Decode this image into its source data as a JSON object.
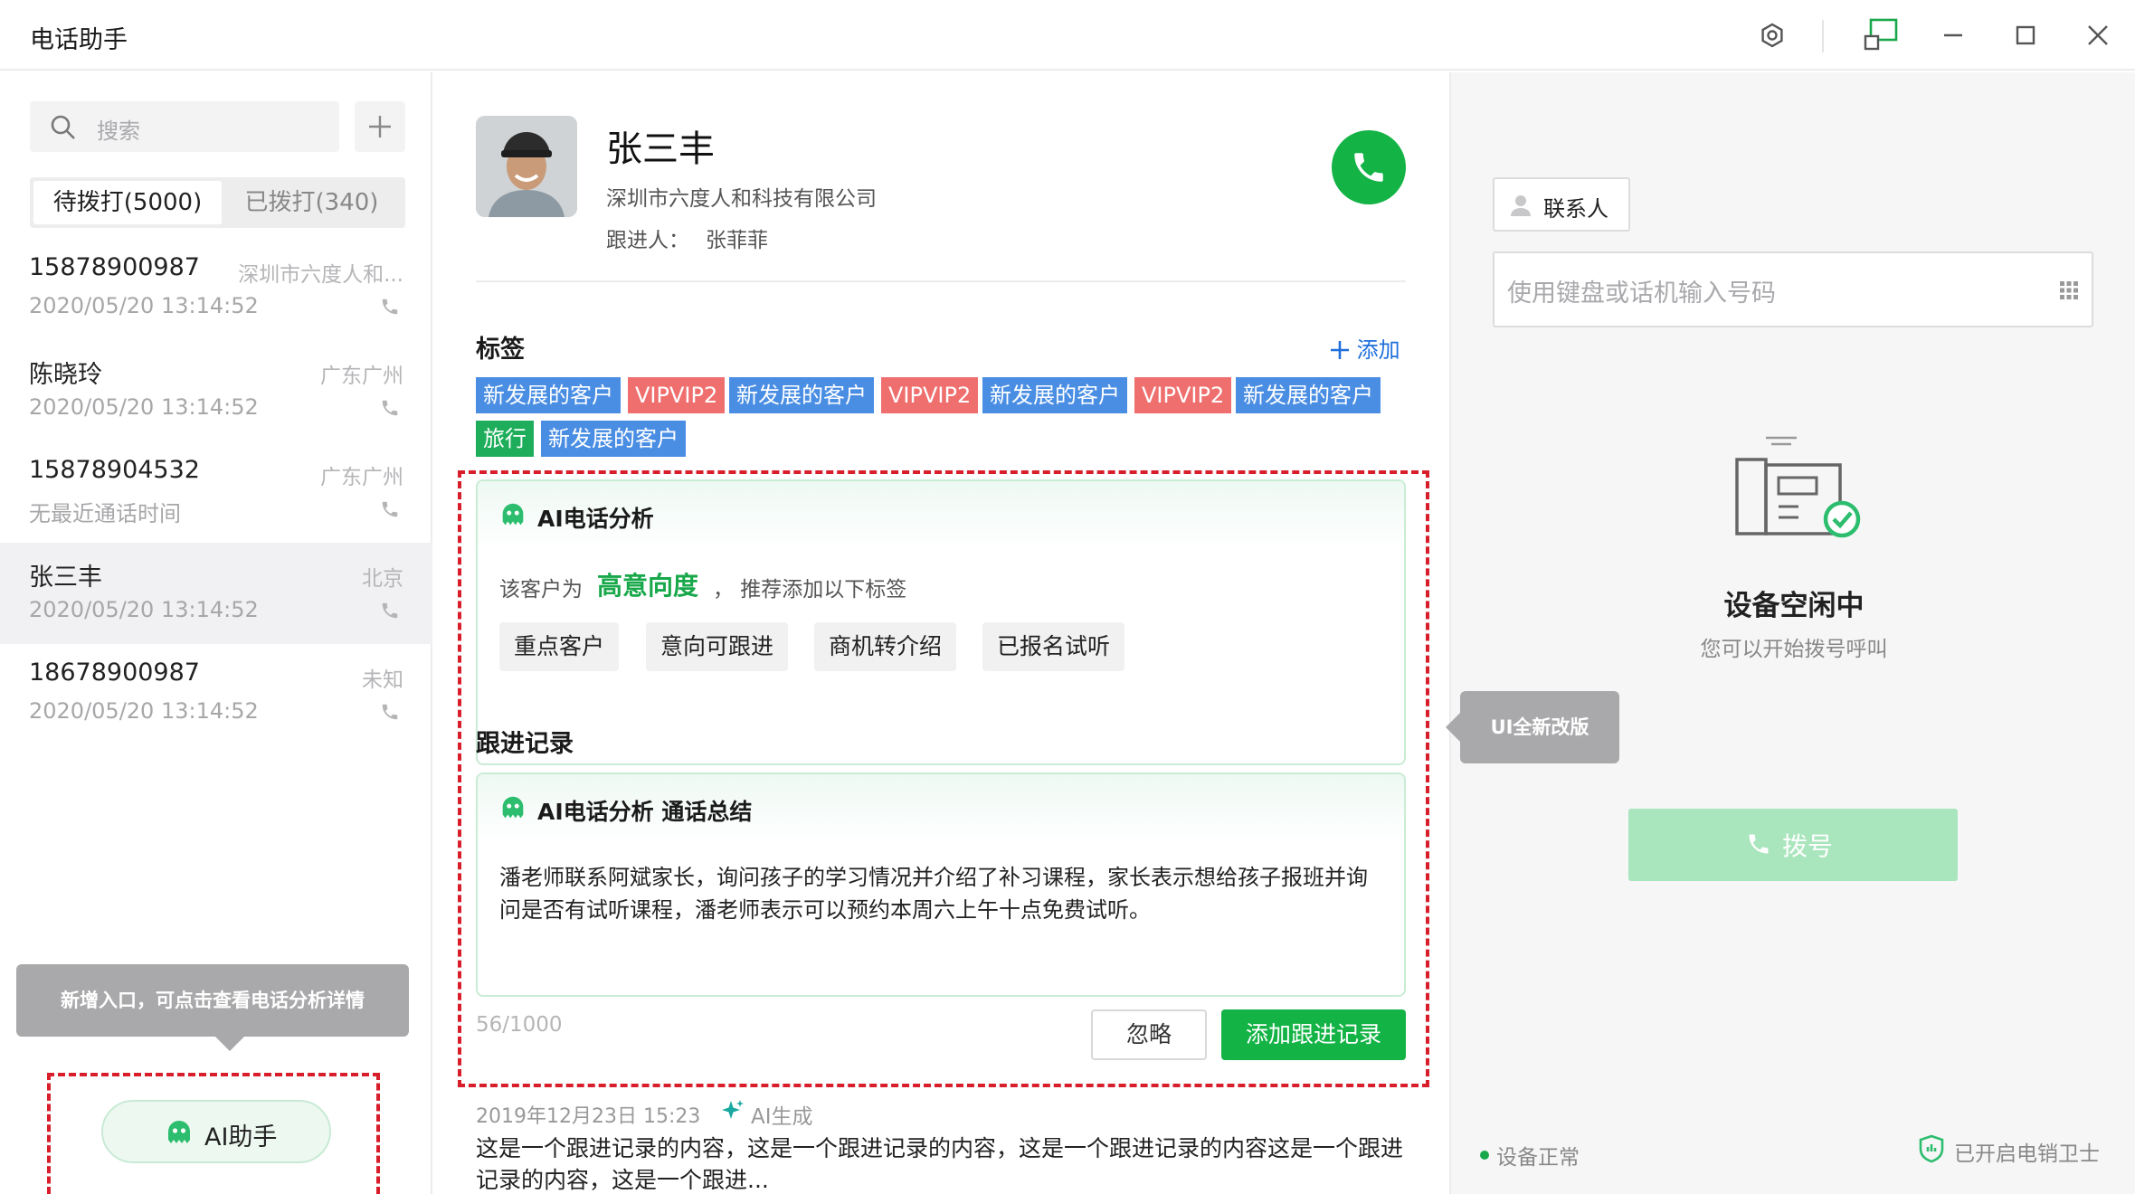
{
  "app": {
    "title": "电话助手"
  },
  "window_controls": {
    "icons": [
      "settings-icon",
      "screen-share-icon",
      "minimize-icon",
      "maximize-icon",
      "close-icon"
    ]
  },
  "sidebar": {
    "search_placeholder": "搜索",
    "tabs": [
      {
        "label": "待拨打(5000)",
        "active": true
      },
      {
        "label": "已拨打(340)",
        "active": false
      }
    ],
    "contacts": [
      {
        "name": "15878900987",
        "location": "深圳市六度人和...",
        "time": "2020/05/20 13:14:52"
      },
      {
        "name": "陈晓玲",
        "location": "广东广州",
        "time": "2020/05/20 13:14:52"
      },
      {
        "name": "15878904532",
        "location": "广东广州",
        "time": "无最近通话时间"
      },
      {
        "name": "张三丰",
        "location": "北京",
        "time": "2020/05/20 13:14:52",
        "selected": true
      },
      {
        "name": "18678900987",
        "location": "未知",
        "time": "2020/05/20 13:14:52"
      }
    ],
    "tooltip": "新增入口，可点击查看电话分析详情",
    "ai_button_label": "AI助手"
  },
  "customer": {
    "name": "张三丰",
    "company": "深圳市六度人和科技有限公司",
    "follower_label": "跟进人：",
    "follower": "张菲菲"
  },
  "tags": {
    "title": "标签",
    "add_label": "添加",
    "items": [
      {
        "label": "新发展的客户",
        "color": "#4a8ee4"
      },
      {
        "label": "VIPVIP2",
        "color": "#ef6f6f"
      },
      {
        "label": "新发展的客户",
        "color": "#4a8ee4"
      },
      {
        "label": "VIPVIP2",
        "color": "#ef6f6f"
      },
      {
        "label": "新发展的客户",
        "color": "#4a8ee4"
      },
      {
        "label": "VIPVIP2",
        "color": "#ef6f6f"
      },
      {
        "label": "新发展的客户",
        "color": "#4a8ee4"
      },
      {
        "label": "旅行",
        "color": "#1eae5b"
      },
      {
        "label": "新发展的客户",
        "color": "#4a8ee4"
      }
    ]
  },
  "ai_analysis": {
    "title": "AI电话分析",
    "intent_prefix": "该客户为",
    "intent_value": "高意向度",
    "intent_suffix": "，  推荐添加以下标签",
    "suggested_tags": [
      "重点客户",
      "意向可跟进",
      "商机转介绍",
      "已报名试听"
    ]
  },
  "follow_records": {
    "title": "跟进记录",
    "summary_title": "AI电话分析 通话总结",
    "summary_text": "潘老师联系阿斌家长，询问孩子的学习情况并介绍了补习课程，家长表示想给孩子报班并询问是否有试听课程，潘老师表示可以预约本周六上午十点免费试听。",
    "counter": "56/1000",
    "ignore_label": "忽略",
    "add_label": "添加跟进记录",
    "record_date": "2019年12月23日  15:23",
    "record_ai_label": "AI生成",
    "record_text": "这是一个跟进记录的内容，这是一个跟进记录的内容，这是一个跟进记录的内容这是一个跟进记录的内容，这是一个跟进..."
  },
  "dialer": {
    "contacts_label": "联系人",
    "input_placeholder": "使用键盘或话机输入号码",
    "idle_title": "设备空闲中",
    "idle_subtitle": "您可以开始拨号呼叫",
    "dial_label": "拨号",
    "status_text": "设备正常",
    "guard_text": "已开启电销卫士"
  },
  "annotation_right": "UI全新改版",
  "colors": {
    "accent_green": "#13b345",
    "annotation_red": "#d81e2b",
    "link_blue": "#1f6fdc"
  }
}
